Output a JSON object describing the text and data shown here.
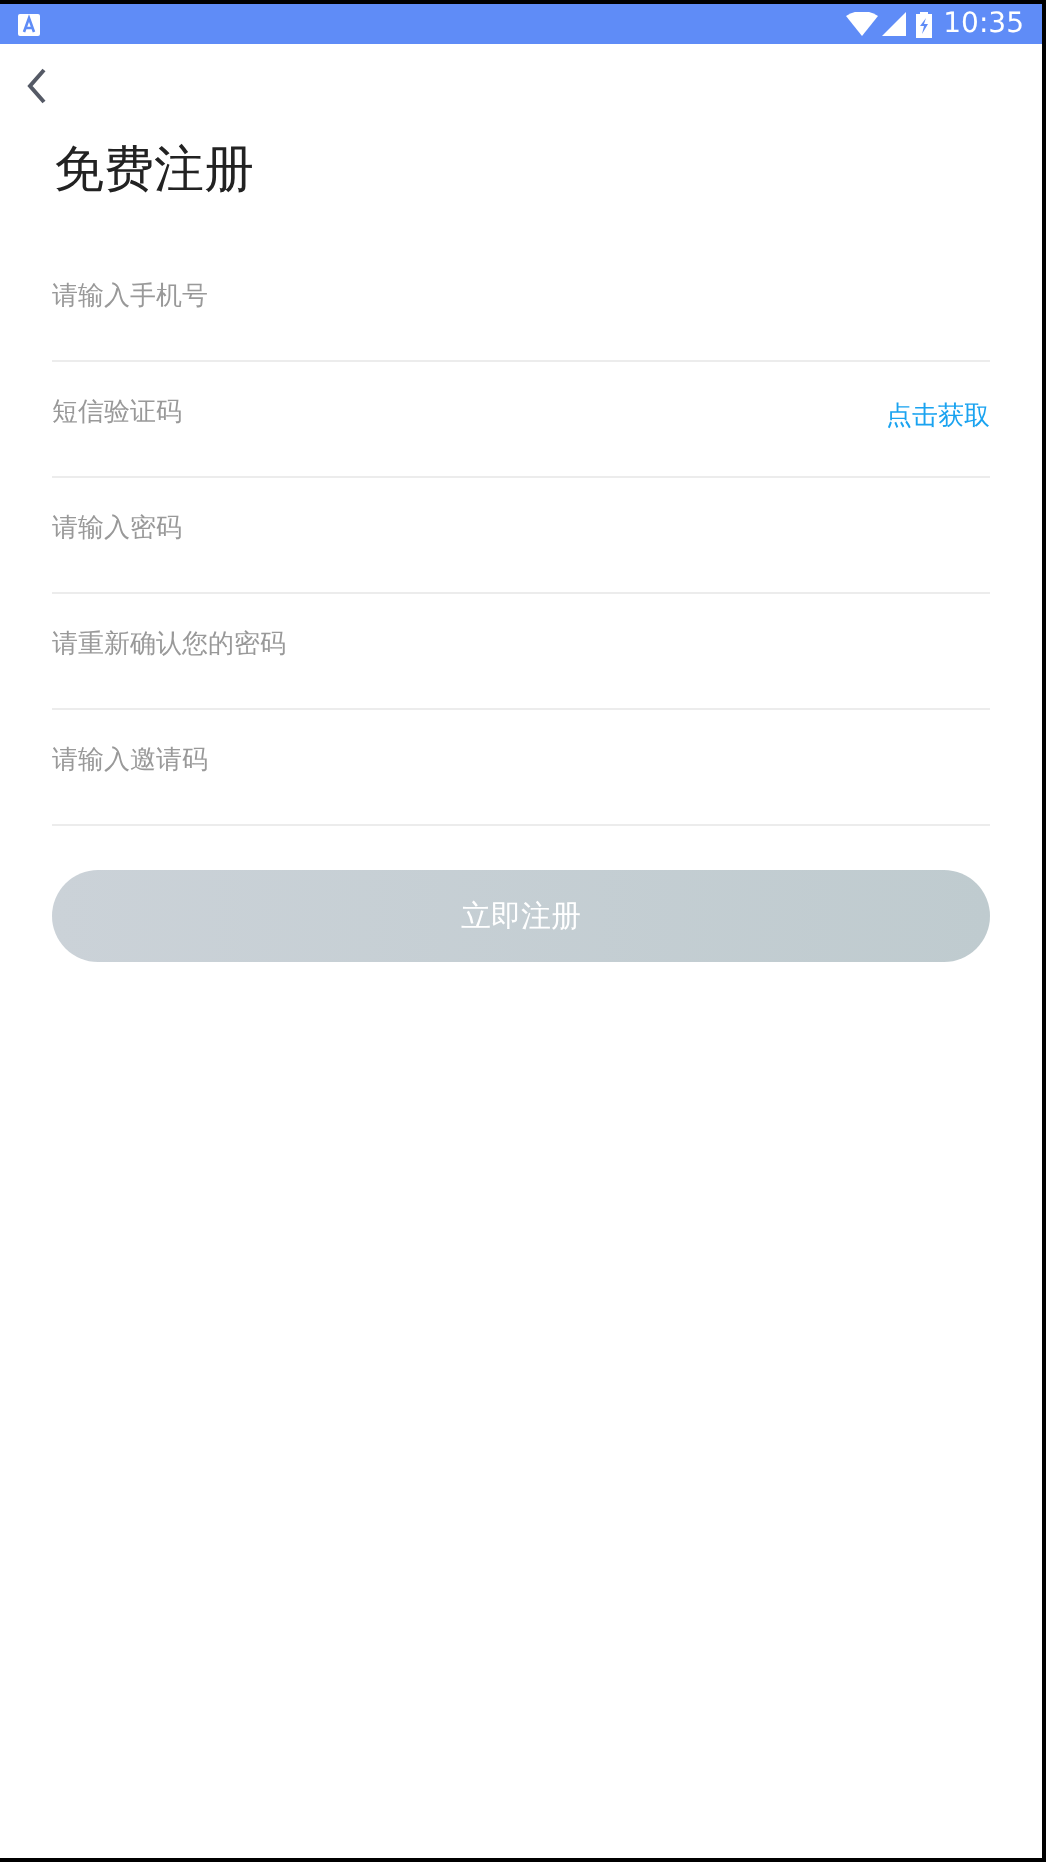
{
  "status_bar": {
    "time": "10:35"
  },
  "title": "免费注册",
  "fields": [
    {
      "kind": "plain",
      "placeholder": "请输入手机号"
    },
    {
      "kind": "code",
      "placeholder": "短信验证码",
      "action": "点击获取"
    },
    {
      "kind": "plain",
      "placeholder": "请输入密码"
    },
    {
      "kind": "plain",
      "placeholder": "请重新确认您的密码"
    },
    {
      "kind": "plain",
      "placeholder": "请输入邀请码"
    }
  ],
  "submit": {
    "label": "立即注册",
    "disabled": true
  }
}
